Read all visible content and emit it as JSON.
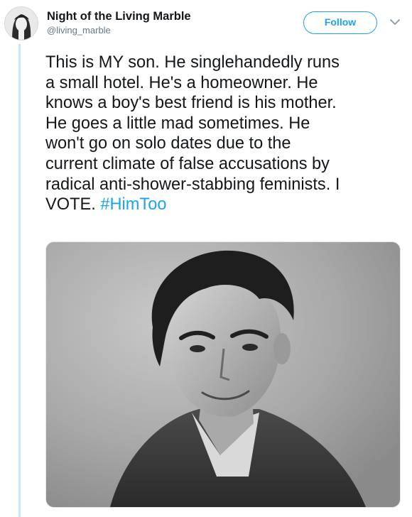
{
  "tweet": {
    "display_name": "Night of the Living Marble",
    "handle": "@living_marble",
    "follow_label": "Follow",
    "text_lines": [
      "This is MY son. He singlehandedly runs",
      "a small hotel. He's a homeowner. He",
      "knows a boy's best friend is his mother.",
      "He goes a little mad sometimes. He",
      "won't go on solo dates due to the",
      "current climate of false accusations by",
      "radical anti-shower-stabbing feminists. I"
    ],
    "last_line_text": "VOTE. ",
    "hashtag": "#HimToo",
    "avatar_icon": "profile-photo",
    "more_icon": "chevron-down-icon",
    "accent_color": "#1da1f2",
    "thread_line_color": "#c4e7fb"
  }
}
